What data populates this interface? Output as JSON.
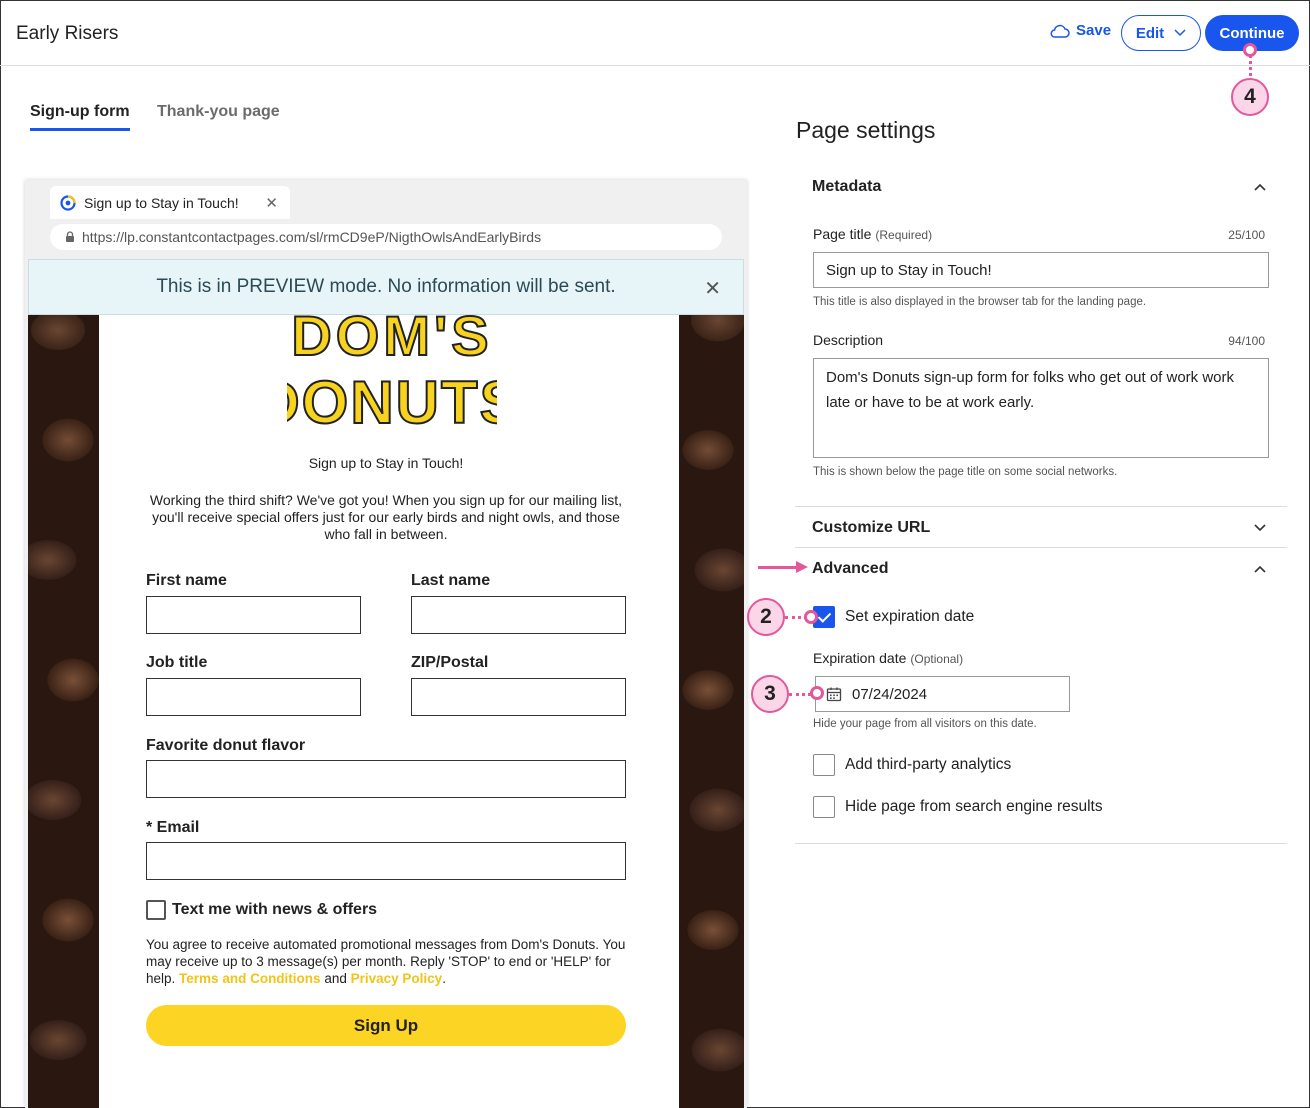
{
  "app": {
    "title": "Early Risers"
  },
  "toolbar": {
    "save_label": "Save",
    "edit_label": "Edit",
    "continue_label": "Continue"
  },
  "tabs": [
    {
      "label": "Sign-up form",
      "active": true
    },
    {
      "label": "Thank-you page",
      "active": false
    }
  ],
  "browser": {
    "tab_title": "Sign up to Stay in Touch!",
    "url": "https://lp.constantcontactpages.com/sl/rmCD9eP/NigthOwlsAndEarlyBirds"
  },
  "preview_banner": "This is in PREVIEW mode. No information will be sent.",
  "form": {
    "logo_text_1": "DOM'S",
    "logo_text_2": "DONUTS",
    "title": "Sign up to Stay in Touch!",
    "intro": "Working the third shift? We've got you! When you sign up for our mailing list, you'll receive special offers just for our early birds and night owls, and those who fall in between.",
    "fields": {
      "first_name": "First name",
      "last_name": "Last name",
      "job_title": "Job title",
      "zip": "ZIP/Postal",
      "flavor": "Favorite donut flavor",
      "email": "* Email"
    },
    "sms_label": "Text me with news & offers",
    "disclaimer": "You agree to receive automated promotional messages from Dom's Donuts. You may receive up to 3 message(s) per month. Reply 'STOP' to end or 'HELP' for help.",
    "terms_link": "Terms and Conditions",
    "and_text": "and",
    "privacy_link": "Privacy Policy",
    "period": ".",
    "submit_label": "Sign Up"
  },
  "settings": {
    "title": "Page settings",
    "metadata": {
      "heading": "Metadata",
      "page_title_label": "Page title",
      "page_title_req": "(Required)",
      "page_title_count": "25/100",
      "page_title_value": "Sign up to Stay in Touch!",
      "page_title_help": "This title is also displayed in the browser tab for the landing page.",
      "description_label": "Description",
      "description_count": "94/100",
      "description_value": "Dom's Donuts sign-up form for folks who get out of work work late or have to be at work early.",
      "description_help": "This is shown below the page title on some social networks."
    },
    "customize_url": {
      "heading": "Customize URL"
    },
    "advanced": {
      "heading": "Advanced",
      "expiration_checkbox": "Set expiration date",
      "expiration_checked": true,
      "expiration_label": "Expiration date",
      "expiration_opt": "(Optional)",
      "expiration_value": "07/24/2024",
      "expiration_help": "Hide your page from all visitors on this date.",
      "analytics_label": "Add third-party analytics",
      "hide_search_label": "Hide page from search engine results"
    }
  },
  "annotations": {
    "badge_2": "2",
    "badge_3": "3",
    "badge_4": "4"
  },
  "colors": {
    "accent": "#1856ed",
    "annotation": "#e4579a",
    "signup_button": "#fcd423"
  }
}
